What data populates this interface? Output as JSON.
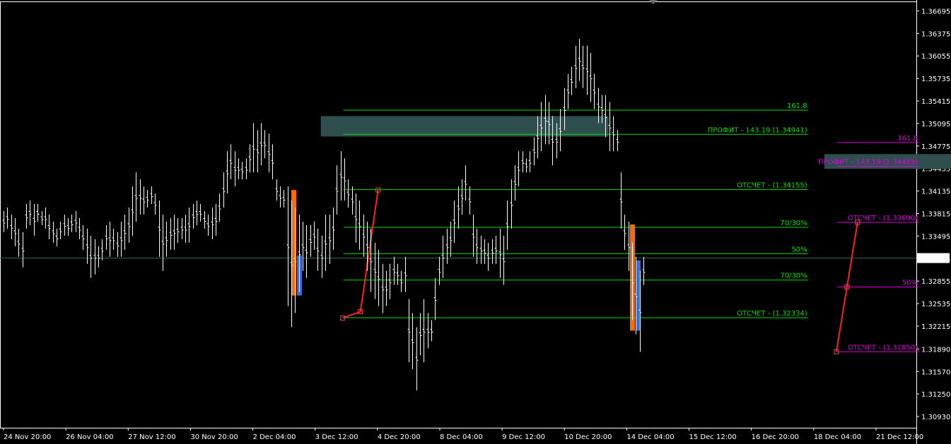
{
  "chart_data": {
    "type": "candlestick",
    "instrument_scale": "price",
    "ylim": [
      1.3077,
      1.3682
    ],
    "price_ticks": [
      "1.36695",
      "1.36375",
      "1.36055",
      "1.35735",
      "1.35415",
      "1.35095",
      "1.34775",
      "1.34455",
      "1.34135",
      "1.33815",
      "1.33495",
      "1.33175",
      "1.32855",
      "1.32535",
      "1.32215",
      "1.31890",
      "1.31570",
      "1.31250",
      "1.30930"
    ],
    "current_price": "1.33182",
    "time_labels": [
      "24 Nov 20:00",
      "26 Nov 04:00",
      "27 Nov 12:00",
      "30 Nov 20:00",
      "2 Dec 04:00",
      "3 Dec 12:00",
      "4 Dec 20:00",
      "8 Dec 04:00",
      "9 Dec 12:00",
      "10 Dec 20:00",
      "14 Dec 04:00",
      "15 Dec 12:00",
      "16 Dec 20:00",
      "18 Dec 04:00",
      "21 Dec 12:00"
    ],
    "bars_hl": [
      [
        1.3385,
        1.3355
      ],
      [
        1.339,
        1.336
      ],
      [
        1.338,
        1.3345
      ],
      [
        1.3375,
        1.3335
      ],
      [
        1.336,
        1.332
      ],
      [
        1.3355,
        1.3305
      ],
      [
        1.3395,
        1.336
      ],
      [
        1.34,
        1.3365
      ],
      [
        1.3395,
        1.335
      ],
      [
        1.3395,
        1.337
      ],
      [
        1.3385,
        1.3365
      ],
      [
        1.339,
        1.336
      ],
      [
        1.338,
        1.3345
      ],
      [
        1.337,
        1.334
      ],
      [
        1.336,
        1.3335
      ],
      [
        1.337,
        1.3345
      ],
      [
        1.338,
        1.335
      ],
      [
        1.3375,
        1.335
      ],
      [
        1.338,
        1.3355
      ],
      [
        1.3385,
        1.3355
      ],
      [
        1.3375,
        1.3345
      ],
      [
        1.3365,
        1.333
      ],
      [
        1.336,
        1.331
      ],
      [
        1.335,
        1.329
      ],
      [
        1.3345,
        1.3295
      ],
      [
        1.3335,
        1.3305
      ],
      [
        1.3345,
        1.3315
      ],
      [
        1.3365,
        1.333
      ],
      [
        1.337,
        1.332
      ],
      [
        1.336,
        1.333
      ],
      [
        1.3355,
        1.332
      ],
      [
        1.337,
        1.332
      ],
      [
        1.338,
        1.333
      ],
      [
        1.339,
        1.334
      ],
      [
        1.342,
        1.335
      ],
      [
        1.344,
        1.337
      ],
      [
        1.343,
        1.338
      ],
      [
        1.342,
        1.338
      ],
      [
        1.3415,
        1.339
      ],
      [
        1.342,
        1.3395
      ],
      [
        1.341,
        1.338
      ],
      [
        1.34,
        1.332
      ],
      [
        1.338,
        1.33
      ],
      [
        1.337,
        1.332
      ],
      [
        1.3375,
        1.333
      ],
      [
        1.338,
        1.333
      ],
      [
        1.3375,
        1.334
      ],
      [
        1.3375,
        1.3345
      ],
      [
        1.338,
        1.334
      ],
      [
        1.339,
        1.334
      ],
      [
        1.3395,
        1.336
      ],
      [
        1.34,
        1.3365
      ],
      [
        1.3395,
        1.337
      ],
      [
        1.3385,
        1.336
      ],
      [
        1.338,
        1.335
      ],
      [
        1.339,
        1.3345
      ],
      [
        1.3395,
        1.335
      ],
      [
        1.341,
        1.337
      ],
      [
        1.344,
        1.339
      ],
      [
        1.347,
        1.341
      ],
      [
        1.348,
        1.343
      ],
      [
        1.347,
        1.342
      ],
      [
        1.346,
        1.343
      ],
      [
        1.3455,
        1.343
      ],
      [
        1.346,
        1.343
      ],
      [
        1.348,
        1.344
      ],
      [
        1.351,
        1.344
      ],
      [
        1.35,
        1.344
      ],
      [
        1.351,
        1.345
      ],
      [
        1.35,
        1.346
      ],
      [
        1.3495,
        1.344
      ],
      [
        1.348,
        1.343
      ],
      [
        1.343,
        1.34
      ],
      [
        1.342,
        1.339
      ],
      [
        1.3415,
        1.339
      ],
      [
        1.342,
        1.325
      ],
      [
        1.34,
        1.322
      ],
      [
        1.339,
        1.324
      ],
      [
        1.338,
        1.327
      ],
      [
        1.337,
        1.33
      ],
      [
        1.3365,
        1.329
      ],
      [
        1.3365,
        1.332
      ],
      [
        1.337,
        1.333
      ],
      [
        1.336,
        1.33
      ],
      [
        1.335,
        1.329
      ],
      [
        1.338,
        1.33
      ],
      [
        1.338,
        1.331
      ],
      [
        1.339,
        1.333
      ],
      [
        1.345,
        1.338
      ],
      [
        1.347,
        1.34
      ],
      [
        1.346,
        1.34
      ],
      [
        1.343,
        1.339
      ],
      [
        1.342,
        1.338
      ],
      [
        1.341,
        1.334
      ],
      [
        1.34,
        1.333
      ],
      [
        1.338,
        1.332
      ],
      [
        1.337,
        1.33
      ],
      [
        1.336,
        1.327
      ],
      [
        1.334,
        1.326
      ],
      [
        1.333,
        1.325
      ],
      [
        1.331,
        1.324
      ],
      [
        1.33,
        1.325
      ],
      [
        1.331,
        1.326
      ],
      [
        1.332,
        1.328
      ],
      [
        1.331,
        1.328
      ],
      [
        1.33,
        1.327
      ],
      [
        1.332,
        1.327
      ],
      [
        1.326,
        1.317
      ],
      [
        1.324,
        1.316
      ],
      [
        1.322,
        1.313
      ],
      [
        1.324,
        1.318
      ],
      [
        1.326,
        1.317
      ],
      [
        1.324,
        1.319
      ],
      [
        1.323,
        1.32
      ],
      [
        1.329,
        1.323
      ],
      [
        1.332,
        1.328
      ],
      [
        1.335,
        1.329
      ],
      [
        1.336,
        1.331
      ],
      [
        1.337,
        1.332
      ],
      [
        1.34,
        1.334
      ],
      [
        1.342,
        1.336
      ],
      [
        1.343,
        1.338
      ],
      [
        1.345,
        1.34
      ],
      [
        1.342,
        1.338
      ],
      [
        1.338,
        1.332
      ],
      [
        1.336,
        1.331
      ],
      [
        1.335,
        1.331
      ],
      [
        1.3345,
        1.331
      ],
      [
        1.334,
        1.33
      ],
      [
        1.3345,
        1.331
      ],
      [
        1.335,
        1.331
      ],
      [
        1.336,
        1.329
      ],
      [
        1.335,
        1.328
      ],
      [
        1.34,
        1.333
      ],
      [
        1.343,
        1.336
      ],
      [
        1.345,
        1.34
      ],
      [
        1.347,
        1.342
      ],
      [
        1.347,
        1.344
      ],
      [
        1.346,
        1.344
      ],
      [
        1.347,
        1.344
      ],
      [
        1.349,
        1.345
      ],
      [
        1.352,
        1.346
      ],
      [
        1.354,
        1.347
      ],
      [
        1.355,
        1.348
      ],
      [
        1.354,
        1.348
      ],
      [
        1.352,
        1.345
      ],
      [
        1.351,
        1.346
      ],
      [
        1.353,
        1.347
      ],
      [
        1.356,
        1.35
      ],
      [
        1.358,
        1.353
      ],
      [
        1.359,
        1.355
      ],
      [
        1.362,
        1.356
      ],
      [
        1.363,
        1.357
      ],
      [
        1.362,
        1.356
      ],
      [
        1.362,
        1.355
      ],
      [
        1.361,
        1.354
      ],
      [
        1.358,
        1.353
      ],
      [
        1.356,
        1.351
      ],
      [
        1.355,
        1.351
      ],
      [
        1.355,
        1.349
      ],
      [
        1.354,
        1.347
      ],
      [
        1.352,
        1.347
      ],
      [
        1.35,
        1.347
      ],
      [
        1.344,
        1.336
      ],
      [
        1.338,
        1.333
      ],
      [
        1.337,
        1.33
      ],
      [
        1.334,
        1.323
      ],
      [
        1.332,
        1.321
      ],
      [
        1.33,
        1.3185
      ],
      [
        1.332,
        1.328
      ]
    ],
    "overlays": {
      "set1": {
        "color": "#00e000",
        "x_range": [
          "3 Dec 12:00",
          "16 Dec 20:00"
        ],
        "zone": {
          "top": 1.352,
          "bottom": 1.3491
        },
        "levels": [
          {
            "price": 1.35285,
            "label": "161.8"
          },
          {
            "price": 1.34941,
            "label": "ПРОФИТ - 143.19 (1.34941)"
          },
          {
            "price": 1.34155,
            "label": "ОТСЧЕТ - (1.34155)"
          },
          {
            "price": 1.3362,
            "label": "70/30%"
          },
          {
            "price": 1.33245,
            "label": "50%"
          },
          {
            "price": 1.3287,
            "label": "70/30%"
          },
          {
            "price": 1.32334,
            "label": "ОТСЧЕТ - (1.32334)"
          }
        ],
        "swing": [
          [
            1.3233,
            "low"
          ],
          [
            1.3242,
            "mid"
          ],
          [
            1.3415,
            "high"
          ]
        ],
        "bars": [
          {
            "color": "#ff6a00",
            "from": 1.3415,
            "to": 1.3265
          },
          {
            "color": "#3a6fd8",
            "from": 1.3322,
            "to": 1.3265
          }
        ]
      },
      "set2": {
        "color": "#e000e0",
        "x_range": [
          "18 Dec 04:00",
          "21 Dec 12:00"
        ],
        "zone": {
          "top": 1.3466,
          "bottom": 1.3445
        },
        "levels": [
          {
            "price": 1.34825,
            "label": "161.8"
          },
          {
            "price": 1.34485,
            "label": "ПРОФИТ - 143.19 (1.34485)"
          },
          {
            "price": 1.3369,
            "label": "ОТСЧЕТ - (1.33690)"
          },
          {
            "price": 1.3277,
            "label": "50%"
          },
          {
            "price": 1.3185,
            "label": "ОТСЧЕТ - (1.31850)"
          }
        ],
        "swing": [
          [
            1.3185,
            "low"
          ],
          [
            1.3277,
            "mid"
          ],
          [
            1.3369,
            "high"
          ]
        ],
        "bars": [
          {
            "color": "#ff6a00",
            "from": 1.3366,
            "to": 1.3215
          },
          {
            "color": "#3a6fd8",
            "from": 1.3315,
            "to": 1.3215
          }
        ]
      }
    },
    "colors": {
      "background": "#000000",
      "bars": "#ffffff",
      "axis": "#ffffff",
      "zone": "#2f4f4f",
      "current_line": "#2f6f4f"
    }
  }
}
